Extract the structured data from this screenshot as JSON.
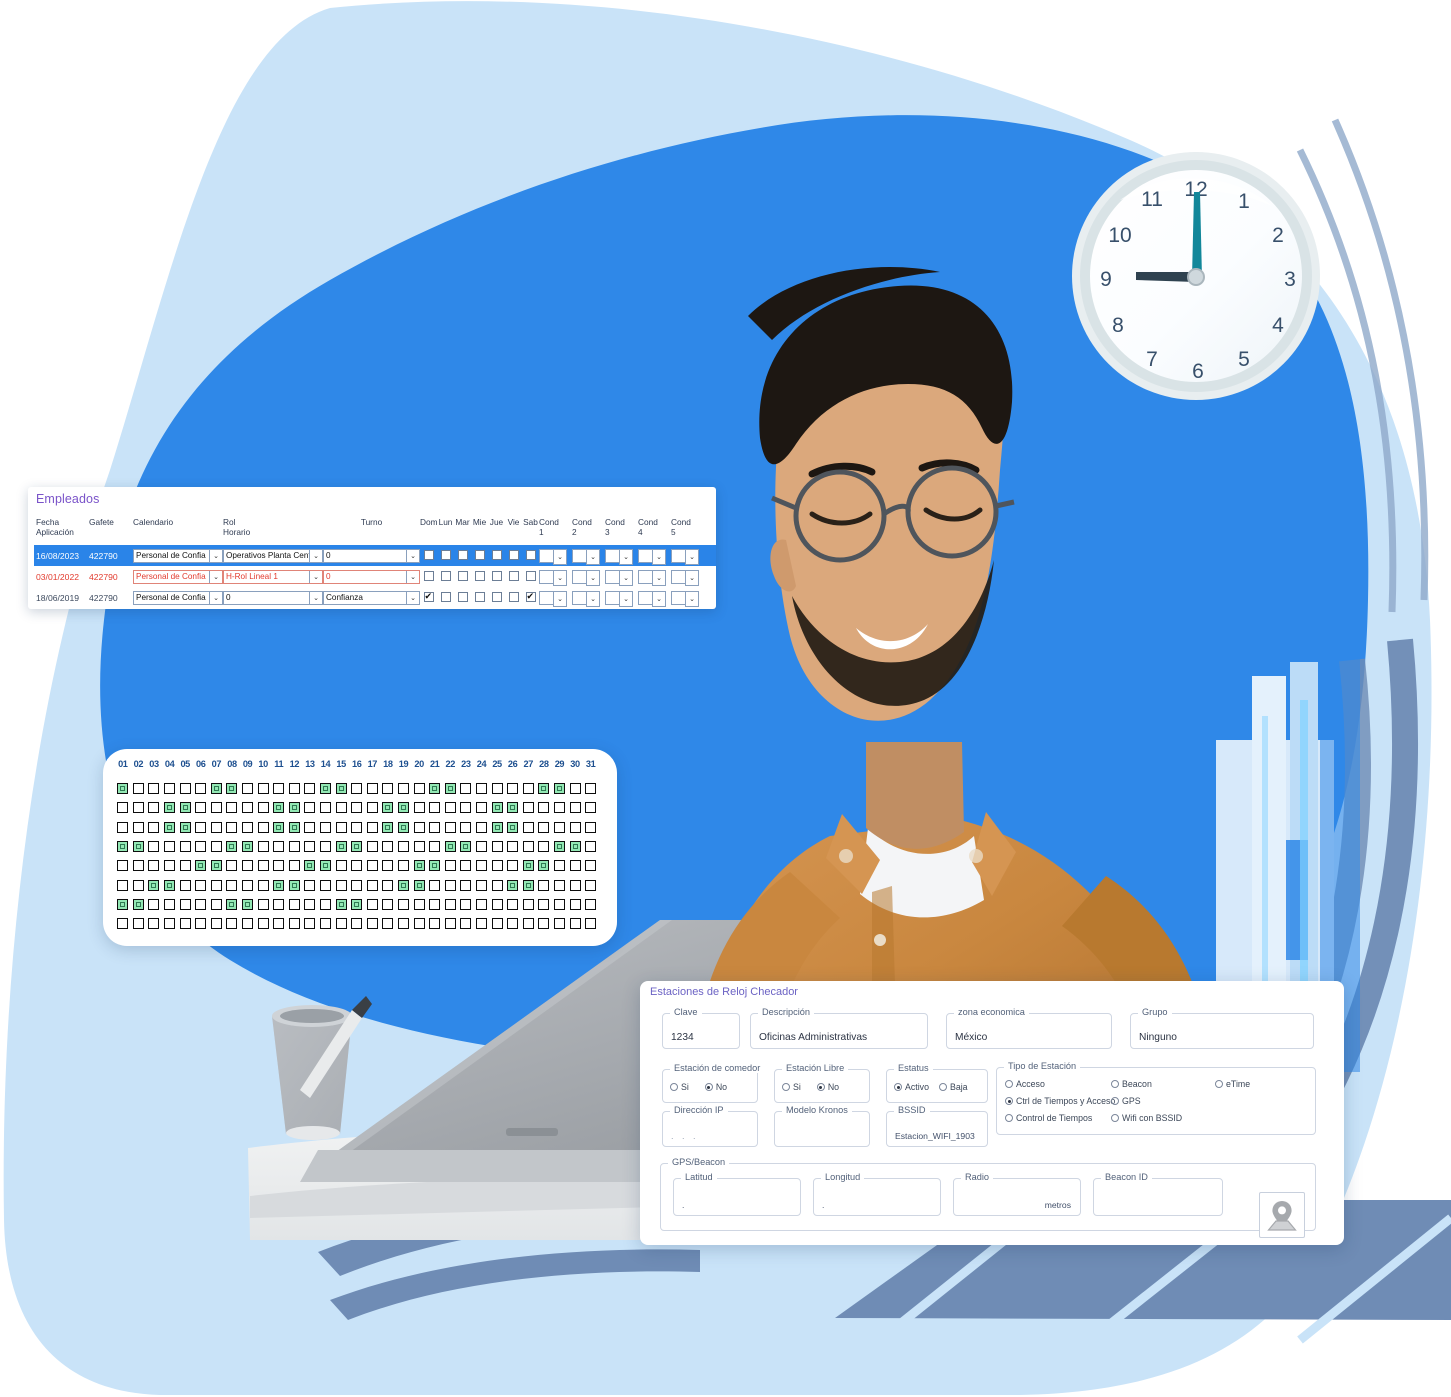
{
  "palette": {
    "blob_light": "#c9e3f8",
    "blob_blue": "#2f88e8",
    "accent_slate": "#6f8cb5",
    "grid_green": "#93e8b4",
    "title_purple": "#7a53c9",
    "row_selected": "#2a84e8",
    "row_red": "#e23b2e"
  },
  "clock": {
    "name": "wall-clock",
    "time": "9:00",
    "hour_hand": 9,
    "minute_hand": 12,
    "numerals": [
      "12",
      "1",
      "2",
      "3",
      "4",
      "5",
      "6",
      "7",
      "8",
      "9",
      "10",
      "11"
    ]
  },
  "empleados": {
    "title": "Empleados",
    "headers": {
      "fecha": "Fecha\nAplicación",
      "fecha_line1": "Fecha",
      "fecha_line2": "Aplicación",
      "gafete": "Gafete",
      "calendario": "Calendario",
      "rol_line1": "Rol",
      "rol_line2": "Horario",
      "turno": "Turno",
      "dias": [
        "Dom",
        "Lun",
        "Mar",
        "Mie",
        "Jue",
        "Vie",
        "Sab"
      ],
      "cond": [
        "Cond 1",
        "Cond 2",
        "Cond 3",
        "Cond 4",
        "Cond 5"
      ],
      "cond_label": "Cond",
      "cond_nums": [
        "1",
        "2",
        "3",
        "4",
        "5"
      ]
    },
    "rows": [
      {
        "state": "selected",
        "fecha": "16/08/2023",
        "gafete": "422790",
        "calendario": "Personal de Confia",
        "rol_horario": "Operativos Planta Cent",
        "turno": "0",
        "dias": [
          false,
          false,
          false,
          false,
          false,
          false,
          false
        ],
        "conds": [
          "",
          "",
          "",
          "",
          ""
        ]
      },
      {
        "state": "red",
        "fecha": "03/01/2022",
        "gafete": "422790",
        "calendario": "Personal de Confia",
        "rol_horario": "H-Rol Lineal 1",
        "turno": "0",
        "dias": [
          false,
          false,
          false,
          false,
          false,
          false,
          false
        ],
        "conds": [
          "",
          "",
          "",
          "",
          ""
        ]
      },
      {
        "state": "grey",
        "fecha": "18/06/2019",
        "gafete": "422790",
        "calendario": "Personal de Confia",
        "rol_horario": "0",
        "turno": "Confianza",
        "dias": [
          true,
          false,
          false,
          false,
          false,
          false,
          true
        ],
        "conds": [
          "",
          "",
          "",
          "",
          ""
        ]
      }
    ]
  },
  "calendar_grid": {
    "columns": [
      "01",
      "02",
      "03",
      "04",
      "05",
      "06",
      "07",
      "08",
      "09",
      "10",
      "11",
      "12",
      "13",
      "14",
      "15",
      "16",
      "17",
      "18",
      "19",
      "20",
      "21",
      "22",
      "23",
      "24",
      "25",
      "26",
      "27",
      "28",
      "29",
      "30",
      "31"
    ],
    "rows": [
      [
        1,
        0,
        0,
        0,
        0,
        0,
        1,
        1,
        0,
        0,
        0,
        0,
        0,
        1,
        1,
        0,
        0,
        0,
        0,
        0,
        1,
        1,
        0,
        0,
        0,
        0,
        0,
        1,
        1,
        0,
        0
      ],
      [
        0,
        0,
        0,
        1,
        1,
        0,
        0,
        0,
        0,
        0,
        1,
        1,
        0,
        0,
        0,
        0,
        0,
        1,
        1,
        0,
        0,
        0,
        0,
        0,
        1,
        1,
        0,
        0,
        0,
        0,
        0
      ],
      [
        0,
        0,
        0,
        1,
        1,
        0,
        0,
        0,
        0,
        0,
        1,
        1,
        0,
        0,
        0,
        0,
        0,
        1,
        1,
        0,
        0,
        0,
        0,
        0,
        1,
        1,
        0,
        0,
        0,
        0,
        0
      ],
      [
        1,
        1,
        0,
        0,
        0,
        0,
        0,
        1,
        1,
        0,
        0,
        0,
        0,
        0,
        1,
        1,
        0,
        0,
        0,
        0,
        0,
        1,
        1,
        0,
        0,
        0,
        0,
        0,
        1,
        1,
        0
      ],
      [
        0,
        0,
        0,
        0,
        0,
        1,
        1,
        0,
        0,
        0,
        0,
        0,
        1,
        1,
        0,
        0,
        0,
        0,
        0,
        1,
        1,
        0,
        0,
        0,
        0,
        0,
        1,
        1,
        0,
        0,
        0
      ],
      [
        0,
        0,
        1,
        1,
        0,
        0,
        0,
        0,
        0,
        0,
        1,
        1,
        0,
        0,
        0,
        0,
        0,
        0,
        1,
        1,
        0,
        0,
        0,
        0,
        0,
        1,
        1,
        0,
        0,
        0,
        0
      ],
      [
        1,
        1,
        0,
        0,
        0,
        0,
        0,
        1,
        1,
        0,
        0,
        0,
        0,
        0,
        1,
        1,
        0,
        0,
        0,
        0,
        0,
        0,
        0,
        0,
        0,
        0,
        0,
        0,
        0,
        0,
        0
      ],
      [
        0,
        0,
        0,
        0,
        0,
        0,
        0,
        0,
        0,
        0,
        0,
        0,
        0,
        0,
        0,
        0,
        0,
        0,
        0,
        0,
        0,
        0,
        0,
        0,
        0,
        0,
        0,
        0,
        0,
        0,
        0
      ]
    ]
  },
  "estaciones": {
    "title": "Estaciones de Reloj Checador",
    "clave": {
      "label": "Clave",
      "value": "1234"
    },
    "descripcion": {
      "label": "Descripción",
      "value": "Oficinas Administrativas"
    },
    "zona_economica": {
      "label": "zona economica",
      "value": "México"
    },
    "grupo": {
      "label": "Grupo",
      "value": "Ninguno"
    },
    "estacion_comedor": {
      "label": "Estación de comedor",
      "options": [
        {
          "label": "Si",
          "selected": false
        },
        {
          "label": "No",
          "selected": true
        }
      ]
    },
    "estacion_libre": {
      "label": "Estación Libre",
      "options": [
        {
          "label": "Si",
          "selected": false
        },
        {
          "label": "No",
          "selected": true
        }
      ]
    },
    "estatus": {
      "label": "Estatus",
      "options": [
        {
          "label": "Activo",
          "selected": true
        },
        {
          "label": "Baja",
          "selected": false
        }
      ]
    },
    "direccion_ip": {
      "label": "Dirección IP",
      "value": ".  .  ."
    },
    "modelo_kronos": {
      "label": "Modelo Kronos",
      "value": ""
    },
    "bssid": {
      "label": "BSSID",
      "value": "Estacion_WIFI_1903"
    },
    "tipo_estacion": {
      "label": "Tipo de Estación",
      "options": [
        {
          "label": "Acceso",
          "selected": false
        },
        {
          "label": "Beacon",
          "selected": false
        },
        {
          "label": "eTime",
          "selected": false
        },
        {
          "label": "Ctrl de Tiempos y Acceso",
          "selected": true
        },
        {
          "label": "GPS",
          "selected": false
        },
        {
          "label": "Control de Tiempos",
          "selected": false
        },
        {
          "label": "Wifi con BSSID",
          "selected": false
        }
      ]
    },
    "gps_beacon": {
      "label": "GPS/Beacon",
      "latitud": {
        "label": "Latitud",
        "value": "."
      },
      "longitud": {
        "label": "Longitud",
        "value": "."
      },
      "radio": {
        "label": "Radio",
        "value": "",
        "unit": "metros"
      },
      "beacon_id": {
        "label": "Beacon ID",
        "value": ""
      },
      "map_button": "map-pin-icon"
    }
  }
}
